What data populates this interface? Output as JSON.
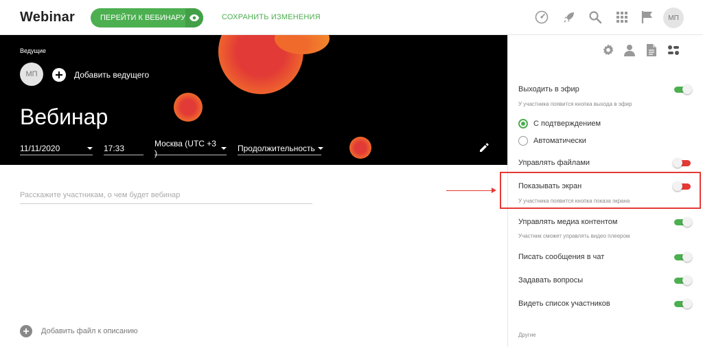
{
  "header": {
    "logo": "Webinar",
    "go_button_label": "ПЕРЕЙТИ К ВЕБИНАРУ",
    "save_label": "СОХРАНИТЬ ИЗМЕНЕНИЯ",
    "avatar_initials": "МП",
    "icons": [
      "speedometer-icon",
      "rocket-icon",
      "search-icon",
      "apps-grid-icon",
      "flag-icon"
    ]
  },
  "hero": {
    "hosts_label": "Ведущие",
    "host_initials": "МП",
    "add_host_label": "Добавить ведущего",
    "title": "Вебинар",
    "date": "11/11/2020",
    "time": "17:33",
    "timezone": "Москва (UTC +3 )",
    "duration": "Продолжительность"
  },
  "description": {
    "placeholder": "Расскажите участникам, о чем будет вебинар",
    "add_file_label": "Добавить файл к описанию"
  },
  "panel": {
    "tabs": [
      "gear-icon",
      "person-icon",
      "document-icon",
      "settings-blocks-icon"
    ],
    "rows": [
      {
        "label": "Выходить в эфир",
        "sub": "У участника появится кнопка выхода в эфир",
        "on": true
      },
      {
        "label": "Управлять файлами",
        "on": false
      },
      {
        "label": "Показывать экран",
        "sub": "У участника появится кнопка показа экрана",
        "on": false
      },
      {
        "label": "Управлять медиа контентом",
        "sub": "Участник сможет управлять видео плеером",
        "on": true
      },
      {
        "label": "Писать сообщения в чат",
        "on": true
      },
      {
        "label": "Задавать вопросы",
        "on": true
      },
      {
        "label": "Видеть список участников",
        "on": true
      }
    ],
    "radio_options": [
      "С подтверждением",
      "Автоматически"
    ],
    "radio_selected": "С подтверждением",
    "other_label": "Другие"
  },
  "colors": {
    "accent_green": "#4caf50",
    "toggle_off_red": "#e53935",
    "hero_background": "#000000",
    "blob_orange": "#f5702a"
  }
}
